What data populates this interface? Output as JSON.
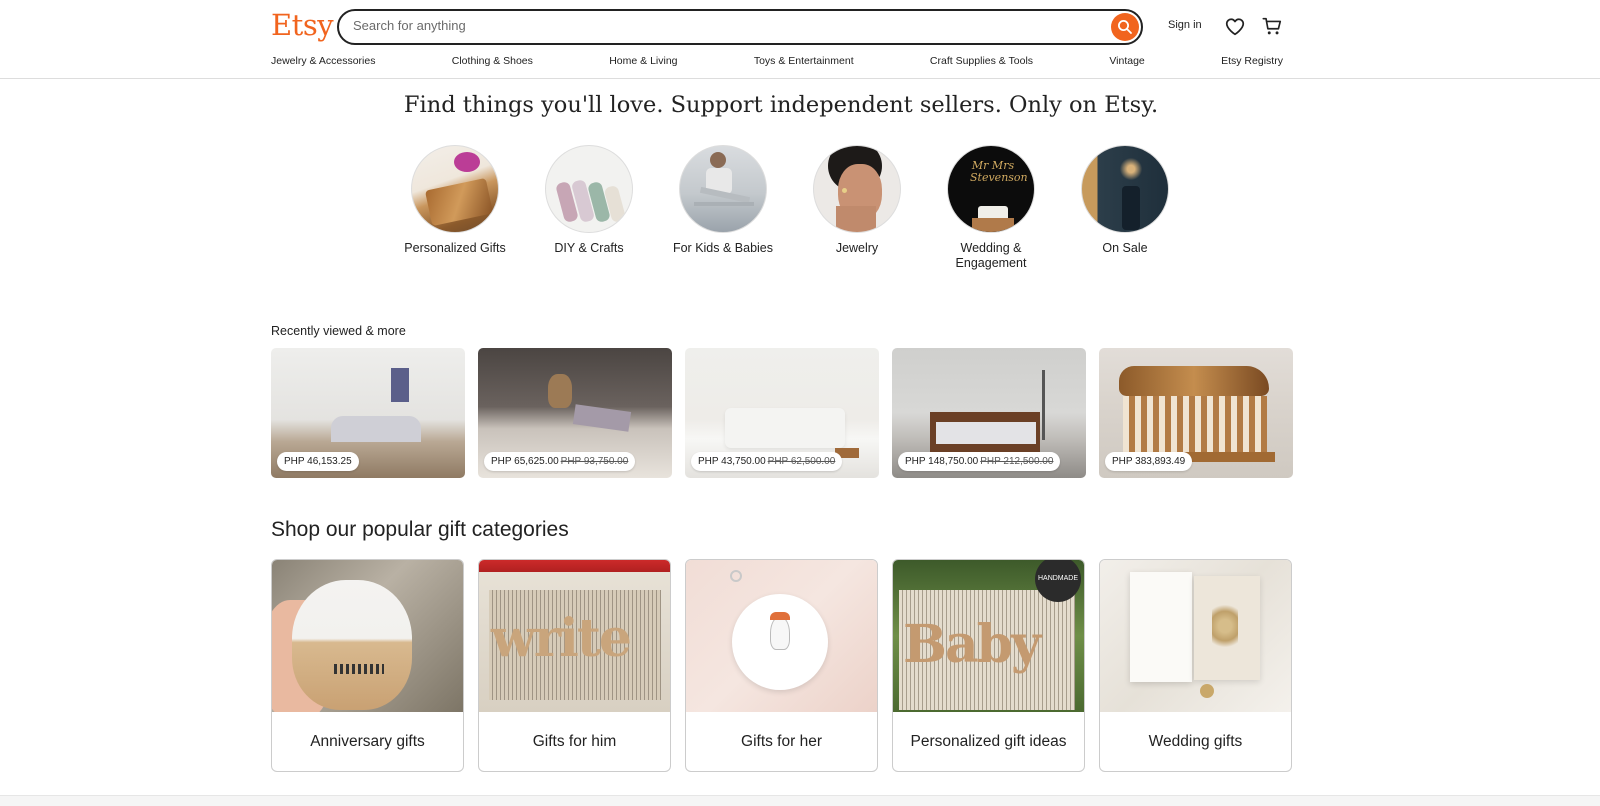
{
  "header": {
    "logo": "Etsy",
    "search_placeholder": "Search for anything",
    "sign_in": "Sign in",
    "nav": [
      "Jewelry & Accessories",
      "Clothing & Shoes",
      "Home & Living",
      "Toys & Entertainment",
      "Craft Supplies & Tools",
      "Vintage",
      "Etsy Registry"
    ]
  },
  "hero": {
    "tagline": "Find things you'll love. Support independent sellers. Only on Etsy.",
    "categories": [
      {
        "label": "Personalized Gifts"
      },
      {
        "label": "DIY & Crafts"
      },
      {
        "label": "For Kids & Babies"
      },
      {
        "label": "Jewelry"
      },
      {
        "label": "Wedding & Engagement"
      },
      {
        "label": "On Sale"
      }
    ]
  },
  "recently_viewed": {
    "title": "Recently viewed & more",
    "items": [
      {
        "price": "PHP 46,153.25",
        "original": ""
      },
      {
        "price": "PHP 65,625.00",
        "original": "PHP 93,750.00"
      },
      {
        "price": "PHP 43,750.00",
        "original": "PHP 62,500.00"
      },
      {
        "price": "PHP 148,750.00",
        "original": "PHP 212,500.00"
      },
      {
        "price": "PHP 383,893.49",
        "original": ""
      }
    ]
  },
  "gifts": {
    "title": "Shop our popular gift categories",
    "items": [
      {
        "label": "Anniversary gifts"
      },
      {
        "label": "Gifts for him"
      },
      {
        "label": "Gifts for her"
      },
      {
        "label": "Personalized gift ideas"
      },
      {
        "label": "Wedding gifts"
      }
    ],
    "badge": "HANDMADE"
  },
  "colors": {
    "brand": "#f1641e",
    "text": "#222222"
  },
  "icons": [
    "search-icon",
    "heart-icon",
    "cart-icon"
  ]
}
